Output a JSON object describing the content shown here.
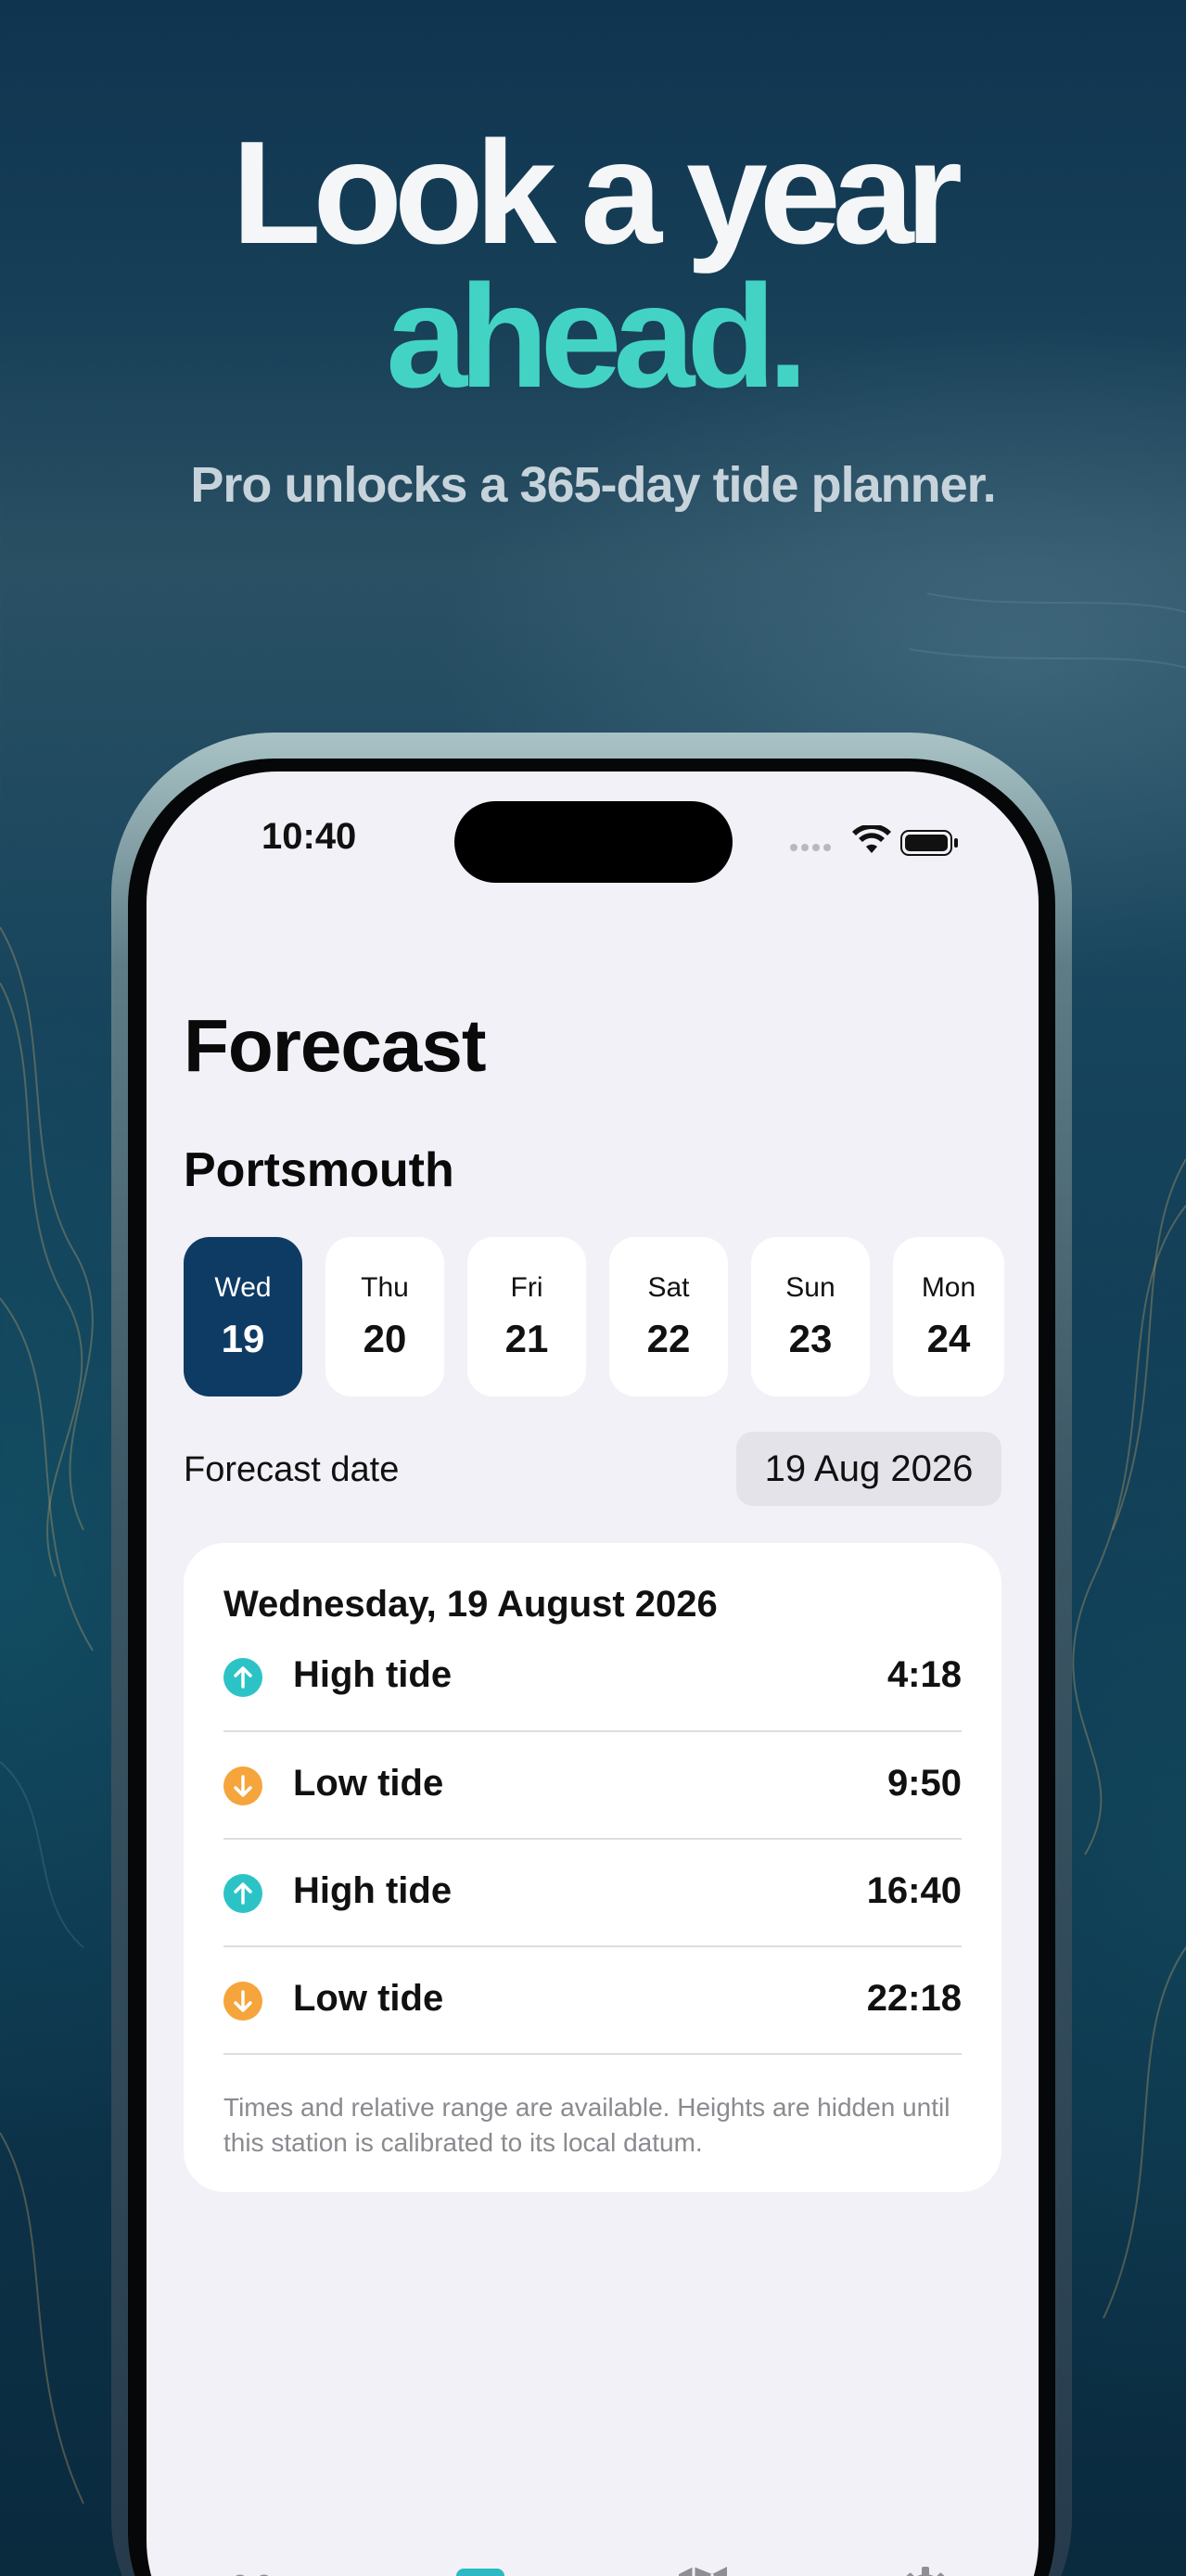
{
  "promo": {
    "headline_line1": "Look a year",
    "headline_line2": "ahead.",
    "subheadline": "Pro unlocks a 365-day tide planner."
  },
  "status_bar": {
    "time": "10:40"
  },
  "screen": {
    "title": "Forecast",
    "location": "Portsmouth",
    "days": [
      {
        "name": "Wed",
        "num": "19",
        "selected": true
      },
      {
        "name": "Thu",
        "num": "20",
        "selected": false
      },
      {
        "name": "Fri",
        "num": "21",
        "selected": false
      },
      {
        "name": "Sat",
        "num": "22",
        "selected": false
      },
      {
        "name": "Sun",
        "num": "23",
        "selected": false
      },
      {
        "name": "Mon",
        "num": "24",
        "selected": false
      }
    ],
    "forecast_date_label": "Forecast date",
    "forecast_date_value": "19 Aug 2026",
    "card": {
      "title": "Wednesday, 19 August 2026",
      "tides": [
        {
          "label": "High tide",
          "time": "4:18",
          "type": "high",
          "icon": "arrow-up-circle-icon"
        },
        {
          "label": "Low tide",
          "time": "9:50",
          "type": "low",
          "icon": "arrow-down-circle-icon"
        },
        {
          "label": "High tide",
          "time": "16:40",
          "type": "high",
          "icon": "arrow-up-circle-icon"
        },
        {
          "label": "Low tide",
          "time": "22:18",
          "type": "low",
          "icon": "arrow-down-circle-icon"
        }
      ],
      "footnote": "Times and relative range are available. Heights are hidden until this station is calibrated to its local datum."
    },
    "tabbar": [
      {
        "icon": "waves-icon",
        "active": false
      },
      {
        "icon": "calendar-icon",
        "active": true
      },
      {
        "icon": "map-icon",
        "active": false
      },
      {
        "icon": "gear-icon",
        "active": false
      }
    ]
  },
  "colors": {
    "accent_teal": "#43d3c4",
    "high_tide": "#2cc3c6",
    "low_tide": "#f5a53b",
    "selected_day": "#0e3b64",
    "screen_bg": "#f2f1f7"
  }
}
